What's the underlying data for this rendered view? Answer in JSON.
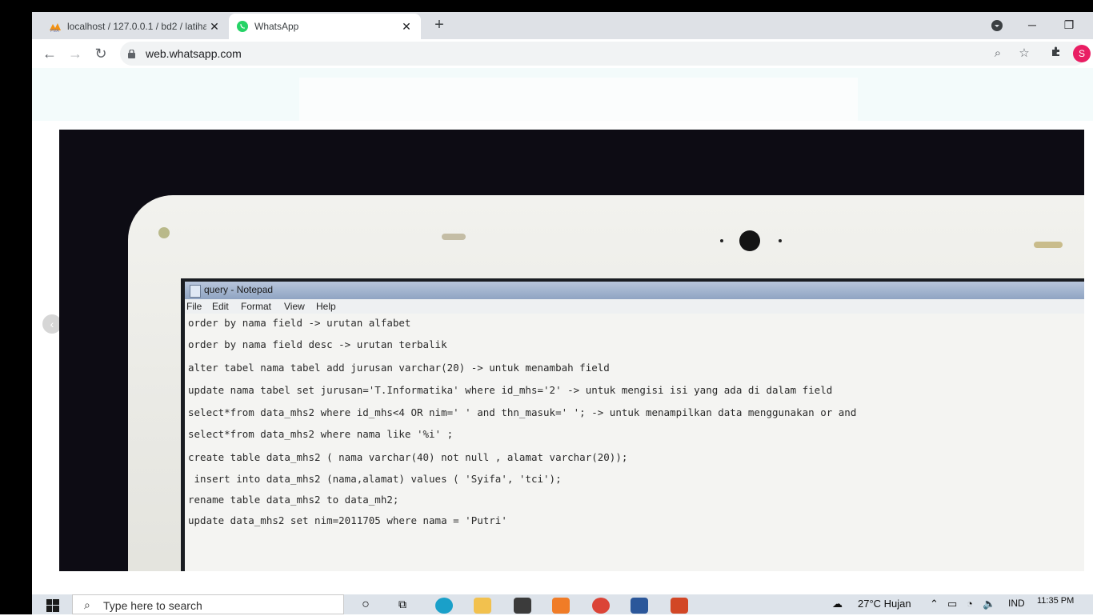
{
  "browser": {
    "tabs": [
      {
        "title": "localhost / 127.0.0.1 / bd2 / latiha",
        "favicon": "phpmyadmin-icon"
      },
      {
        "title": "WhatsApp",
        "favicon": "whatsapp-icon"
      }
    ],
    "new_tab_label": "+",
    "url": "web.whatsapp.com",
    "profile_initial": "S"
  },
  "photo": {
    "notepad": {
      "title": "query - Notepad",
      "menu": [
        "File",
        "Edit",
        "Format",
        "View",
        "Help"
      ],
      "lines": [
        "order by nama field -> urutan alfabet",
        "order by nama field desc -> urutan terbalik",
        "alter tabel nama tabel add jurusan varchar(20) -> untuk menambah field",
        "update nama tabel set jurusan='T.Informatika' where id_mhs='2' -> untuk mengisi isi yang ada di dalam field",
        "select*from data_mhs2 where id_mhs<4 OR nim=' ' and thn_masuk=' '; -> untuk menampilkan data menggunakan or and",
        "select*from data_mhs2 where nama like '%i' ;",
        "create table data_mhs2 ( nama varchar(40) not null , alamat varchar(20));",
        " insert into data_mhs2 (nama,alamat) values ( 'Syifa', 'tci');",
        "rename table data_mhs2 to data_mh2;",
        "update data_mhs2 set nim=2011705 where nama = 'Putri'"
      ]
    }
  },
  "taskbar": {
    "search_placeholder": "Type here to search",
    "weather": "27°C  Hujan",
    "language": "IND",
    "time": "11:35 PM"
  },
  "colors": {
    "accent_profile": "#e91e63",
    "whatsapp_green": "#25d366",
    "tabstrip": "#dee1e6"
  }
}
